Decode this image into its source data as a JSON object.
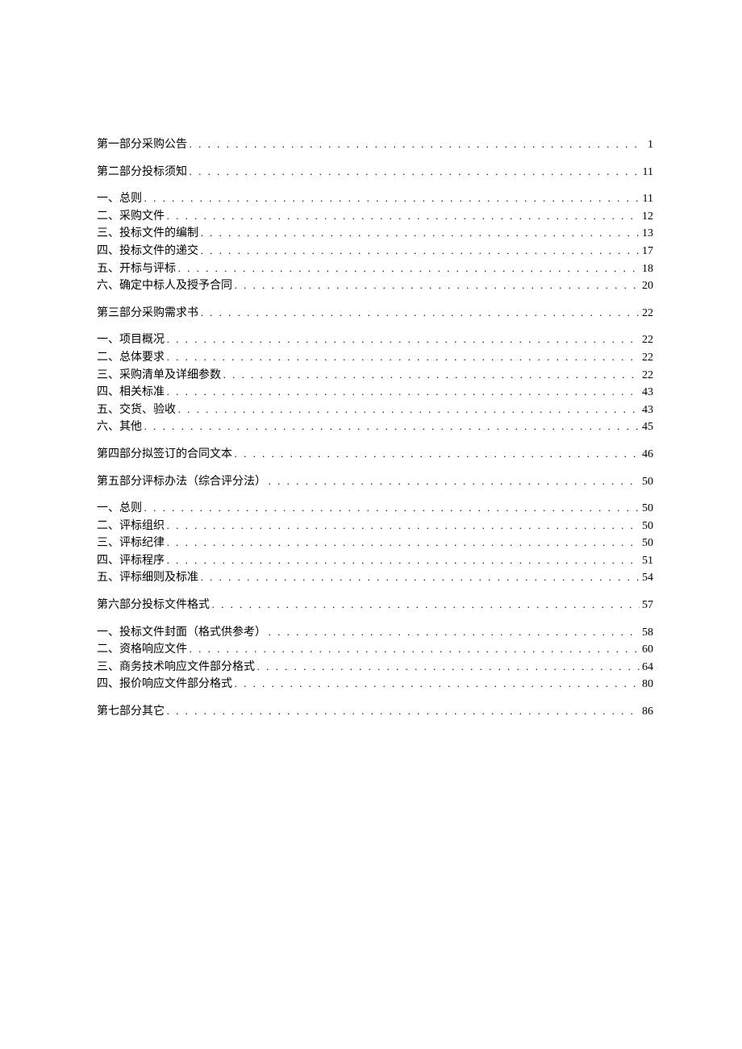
{
  "toc": {
    "sections": [
      {
        "title": "第一部分采购公告",
        "page": "1",
        "children": []
      },
      {
        "title": "第二部分投标须知",
        "page": "11",
        "children": [
          {
            "title": "一、总则",
            "page": "11"
          },
          {
            "title": "二、采购文件",
            "page": "12"
          },
          {
            "title": "三、投标文件的编制",
            "page": "13"
          },
          {
            "title": "四、投标文件的递交",
            "page": "17"
          },
          {
            "title": "五、开标与评标",
            "page": "18"
          },
          {
            "title": "六、确定中标人及授予合同",
            "page": "20"
          }
        ]
      },
      {
        "title": "第三部分采购需求书",
        "page": "22",
        "children": [
          {
            "title": "一、项目概况",
            "page": "22"
          },
          {
            "title": "二、总体要求",
            "page": "22"
          },
          {
            "title": "三、采购清单及详细参数",
            "page": "22"
          },
          {
            "title": "四、相关标准",
            "page": "43"
          },
          {
            "title": "五、交货、验收",
            "page": "43"
          },
          {
            "title": "六、其他",
            "page": "45"
          }
        ]
      },
      {
        "title": "第四部分拟签订的合同文本",
        "page": "46",
        "children": []
      },
      {
        "title": "第五部分评标办法（综合评分法）",
        "page": "50",
        "children": [
          {
            "title": "一、总则",
            "page": "50"
          },
          {
            "title": "二、评标组织",
            "page": "50"
          },
          {
            "title": "三、评标纪律",
            "page": "50"
          },
          {
            "title": "四、评标程序",
            "page": "51"
          },
          {
            "title": "五、评标细则及标准",
            "page": "54"
          }
        ]
      },
      {
        "title": "第六部分投标文件格式",
        "page": "57",
        "children": [
          {
            "title": "一、投标文件封面（格式供参考）",
            "page": "58"
          },
          {
            "title": "二、资格响应文件",
            "page": "60"
          },
          {
            "title": "三、商务技术响应文件部分格式",
            "page": "64"
          },
          {
            "title": "四、报价响应文件部分格式",
            "page": "80"
          }
        ]
      },
      {
        "title": "第七部分其它",
        "page": "86",
        "children": []
      }
    ]
  }
}
